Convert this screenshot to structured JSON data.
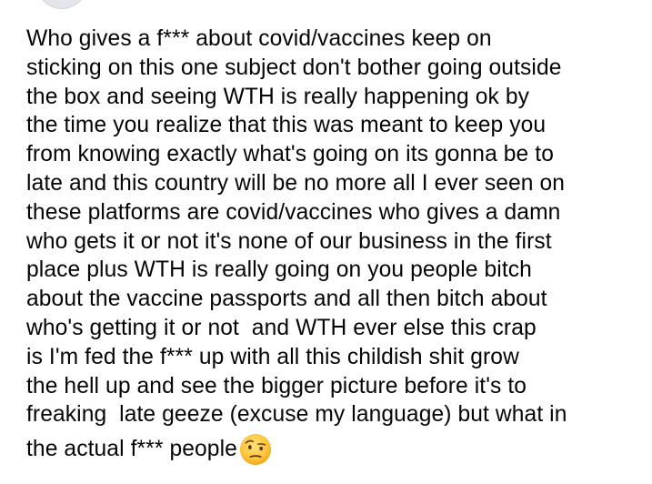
{
  "post": {
    "lines": [
      "Who gives a f*** about covid/vaccines keep on",
      "sticking on this one subject don't bother going outside",
      "the box and seeing WTH is really happening ok by",
      "the time you realize that this was meant to keep you",
      "from knowing exactly what's going on its gonna be to",
      "late and this country will be no more all I ever seen on",
      "these platforms are covid/vaccines who gives a damn",
      "who gets it or not it's none of our business in the first",
      "place plus WTH is really going on you people bitch",
      "about the vaccine passports and all then bitch about",
      "who's getting it or not  and WTH ever else this crap",
      "is I'm fed the f*** up with all this childish shit grow",
      "the hell up and see the bigger picture before it's to",
      "freaking  late geeze (excuse my language) but what in",
      "the actual f*** people"
    ],
    "emoji": "face-with-raised-eyebrow-emoji"
  }
}
